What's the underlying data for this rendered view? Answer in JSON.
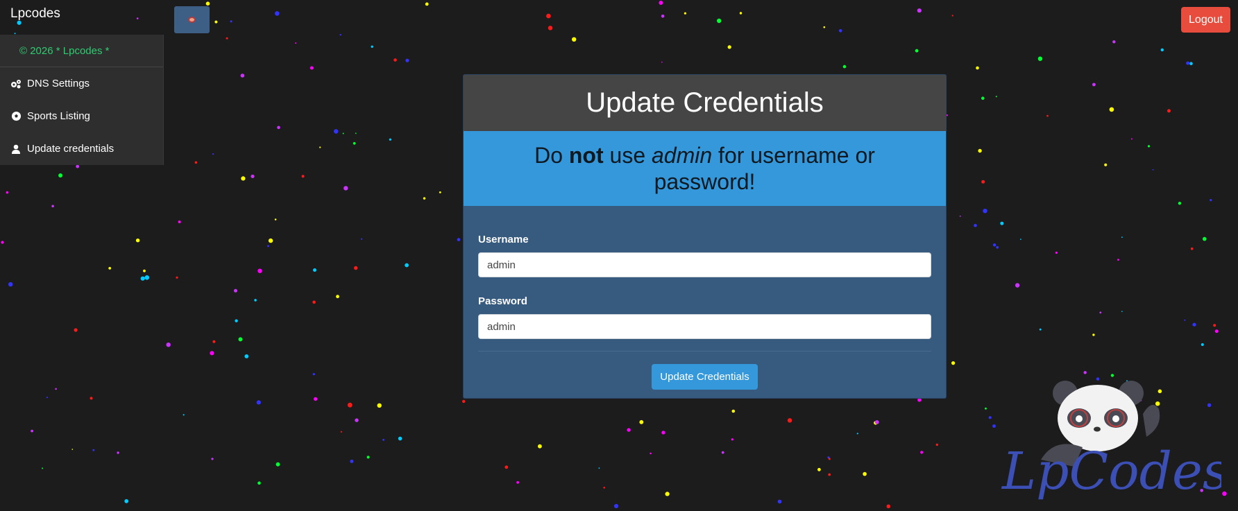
{
  "app": {
    "brand": "Lpcodes"
  },
  "header": {
    "logout_label": "Logout"
  },
  "sidebar": {
    "copyright": "© 2026 * Lpcodes *",
    "items": [
      {
        "label": "DNS Settings",
        "icon": "cogs-icon"
      },
      {
        "label": "Sports Listing",
        "icon": "soccer-ball-icon"
      },
      {
        "label": "Update credentials",
        "icon": "user-icon"
      }
    ]
  },
  "card": {
    "title": "Update Credentials",
    "alert": {
      "before": "Do ",
      "bold": "not",
      "middle": " use ",
      "italic": "admin",
      "after": " for username or password!"
    },
    "username": {
      "label": "Username",
      "value": "admin"
    },
    "password": {
      "label": "Password",
      "value": "admin"
    },
    "submit_label": "Update Credentials"
  },
  "logo": {
    "text": "LpCodes"
  },
  "colors": {
    "background": "#1c1c1c",
    "card": "#375a7f",
    "card_header": "#454545",
    "alert": "#3498db",
    "logout": "#e74c3c",
    "accent_green": "#2ecc71",
    "logo_blue": "#3b4fb5"
  }
}
